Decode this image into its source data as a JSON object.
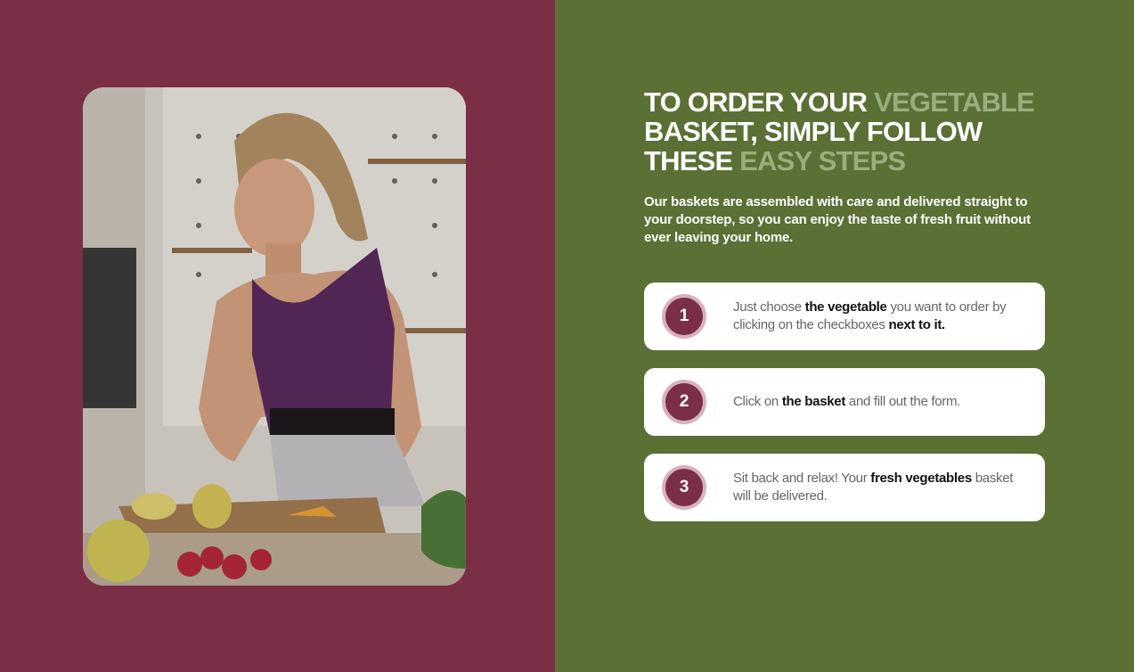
{
  "hero_image": {
    "icon": "woman-cutting-fruit-photo"
  },
  "headline": {
    "part1": "TO ORDER YOUR ",
    "part1_muted": "VEGETABLE",
    "part2": "BASKET, SIMPLY FOLLOW",
    "part3": "THESE ",
    "part3_muted": "EASY STEPS"
  },
  "intro": "Our baskets are assembled with care and delivered straight to your doorstep, so you can enjoy the taste of fresh fruit without ever leaving your home.",
  "steps": [
    {
      "number": "1",
      "pre": "Just choose ",
      "bold1": "the vegetable",
      "mid": " you want to order by clicking on the checkboxes ",
      "bold2": "next to it.",
      "post": ""
    },
    {
      "number": "2",
      "pre": "Click on ",
      "bold1": "the basket",
      "mid": " and fill out the form.",
      "bold2": "",
      "post": ""
    },
    {
      "number": "3",
      "pre": "Sit back and relax! Your ",
      "bold1": "fresh vegetables",
      "mid": " basket will be delivered.",
      "bold2": "",
      "post": ""
    }
  ],
  "colors": {
    "left_bg": "#7b2f47",
    "right_bg": "#5a7035",
    "muted_green": "#9aae7d",
    "badge_ring": "#d8b1be"
  }
}
